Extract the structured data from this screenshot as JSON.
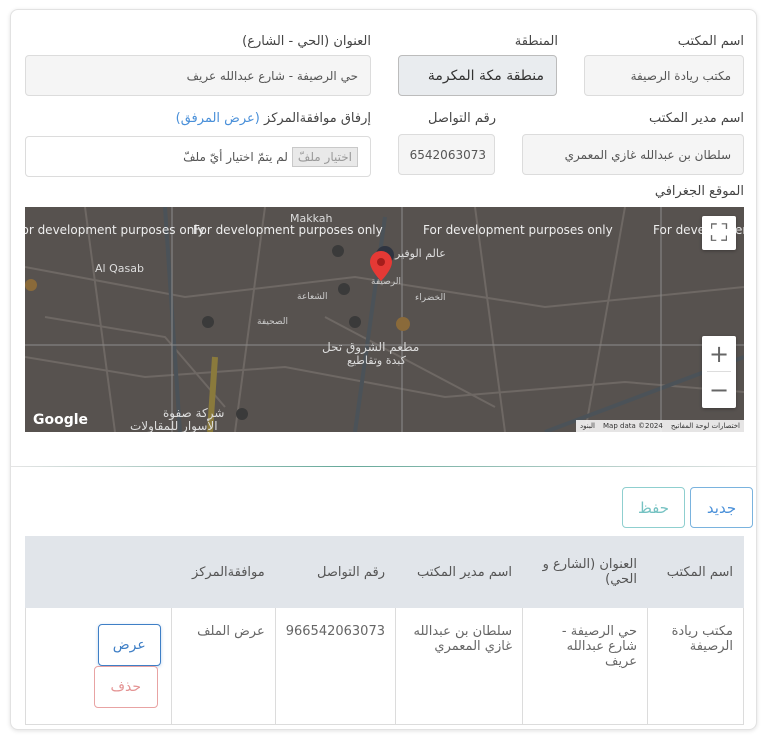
{
  "form": {
    "office_name": {
      "label": "اسم المكتب",
      "value": "مكتب ريادة الرصيفة"
    },
    "region": {
      "label": "المنطقة",
      "value": "منطقة مكة المكرمة"
    },
    "address": {
      "label": "العنوان (الحي - الشارع)",
      "value": "حي الرصيفة - شارع عبدالله عريف"
    },
    "manager": {
      "label": "اسم مدير المكتب",
      "value": "سلطان بن عبدالله غازي المعمري"
    },
    "phone": {
      "label": "رقم التواصل",
      "value": "6542063073"
    },
    "attachment": {
      "label": "إرفاق موافقةالمركز",
      "view_link": "(عرض المرفق)",
      "button": "اختيار ملفّ",
      "status": "لم يتمّ اختيار أيّ ملفّ"
    },
    "location_label": "الموقع الجغرافي"
  },
  "map": {
    "watermark": "For development purposes only",
    "labels": {
      "makkah": "Makkah",
      "rusaifa": "الرصيفة",
      "alam": "عالم الوفير",
      "restaurant": "مطعم الشروق تحل",
      "restaurant2": "كبدة وتقاطيع",
      "company": "شركة صفوة",
      "company2": "الأسوار للمقاولات",
      "qasab": "Al Qasab",
      "khadra": "الخضراء",
      "sahefa": "الصحيفة",
      "shaakha": "الشعاعة"
    },
    "attribution": {
      "shortcuts": "اختصارات لوحة المفاتيح",
      "data": "Map data ©2024",
      "terms": "البنود"
    },
    "google": "Google",
    "fullscreen_icon": "fullscreen-icon",
    "zoom_in_icon": "plus-icon",
    "zoom_out_icon": "minus-icon",
    "pin_color": "#e53935"
  },
  "actions": {
    "new": "جديد",
    "save": "حفظ"
  },
  "table": {
    "headers": [
      "اسم المكتب",
      "العنوان (الشارع و الحي)",
      "اسم مدير المكتب",
      "رقم التواصل",
      "موافقةالمركز",
      ""
    ],
    "rows": [
      {
        "office": "مكتب ريادة الرصيفة",
        "address": "حي الرصيفة - شارع عبدالله عريف",
        "manager": "سلطان بن عبدالله غازي المعمري",
        "phone": "966542063073",
        "approval": "عرض الملف",
        "view": "عرض",
        "delete": "حذف"
      }
    ]
  }
}
